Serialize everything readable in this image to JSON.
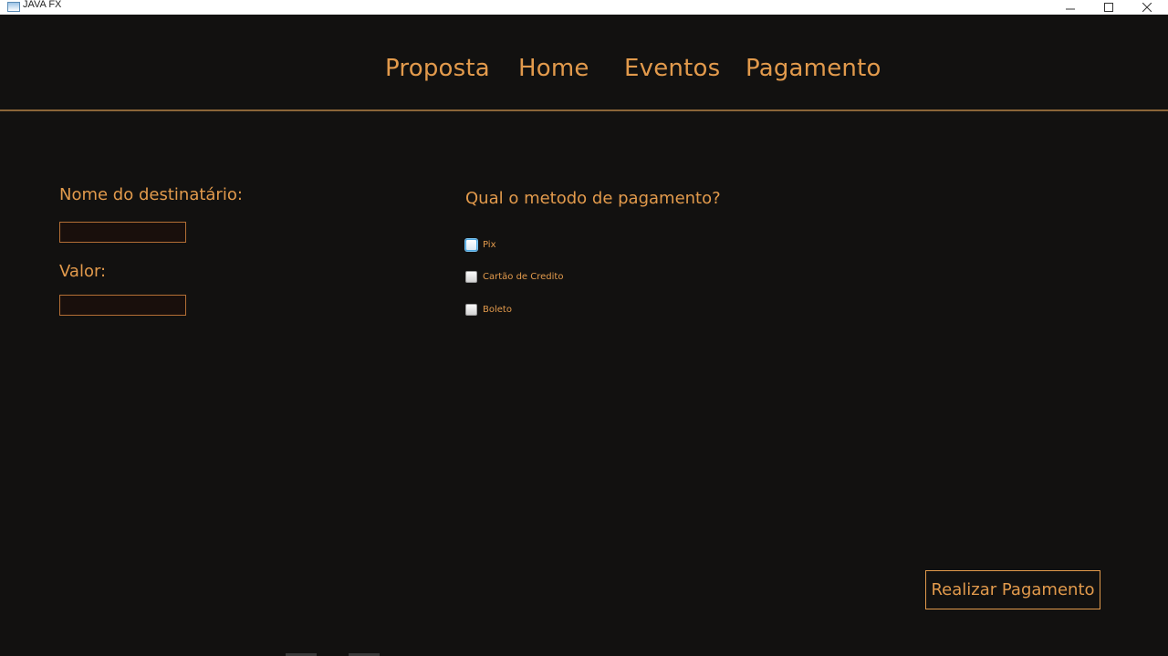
{
  "window": {
    "title": "JAVA FX",
    "icons": [
      "app-icon",
      "minimize-icon",
      "maximize-icon",
      "close-icon"
    ]
  },
  "nav": {
    "items": [
      {
        "label": "Proposta"
      },
      {
        "label": "Home"
      },
      {
        "label": "Eventos"
      },
      {
        "label": "Pagamento"
      }
    ]
  },
  "form": {
    "recipient_label": "Nome do destinatário:",
    "recipient_value": "",
    "amount_label": "Valor:",
    "amount_value": ""
  },
  "payment": {
    "question": "Qual o metodo de pagamento?",
    "options": [
      {
        "label": "Pix",
        "checked": false,
        "focused": true
      },
      {
        "label": "Cartão de Credito",
        "checked": false,
        "focused": false
      },
      {
        "label": "Boleto",
        "checked": false,
        "focused": false
      }
    ]
  },
  "actions": {
    "submit_label": "Realizar Pagamento"
  },
  "colors": {
    "background": "#121110",
    "accent": "#e29a4c",
    "divider": "#8b6538",
    "input_background": "#190f0c"
  }
}
